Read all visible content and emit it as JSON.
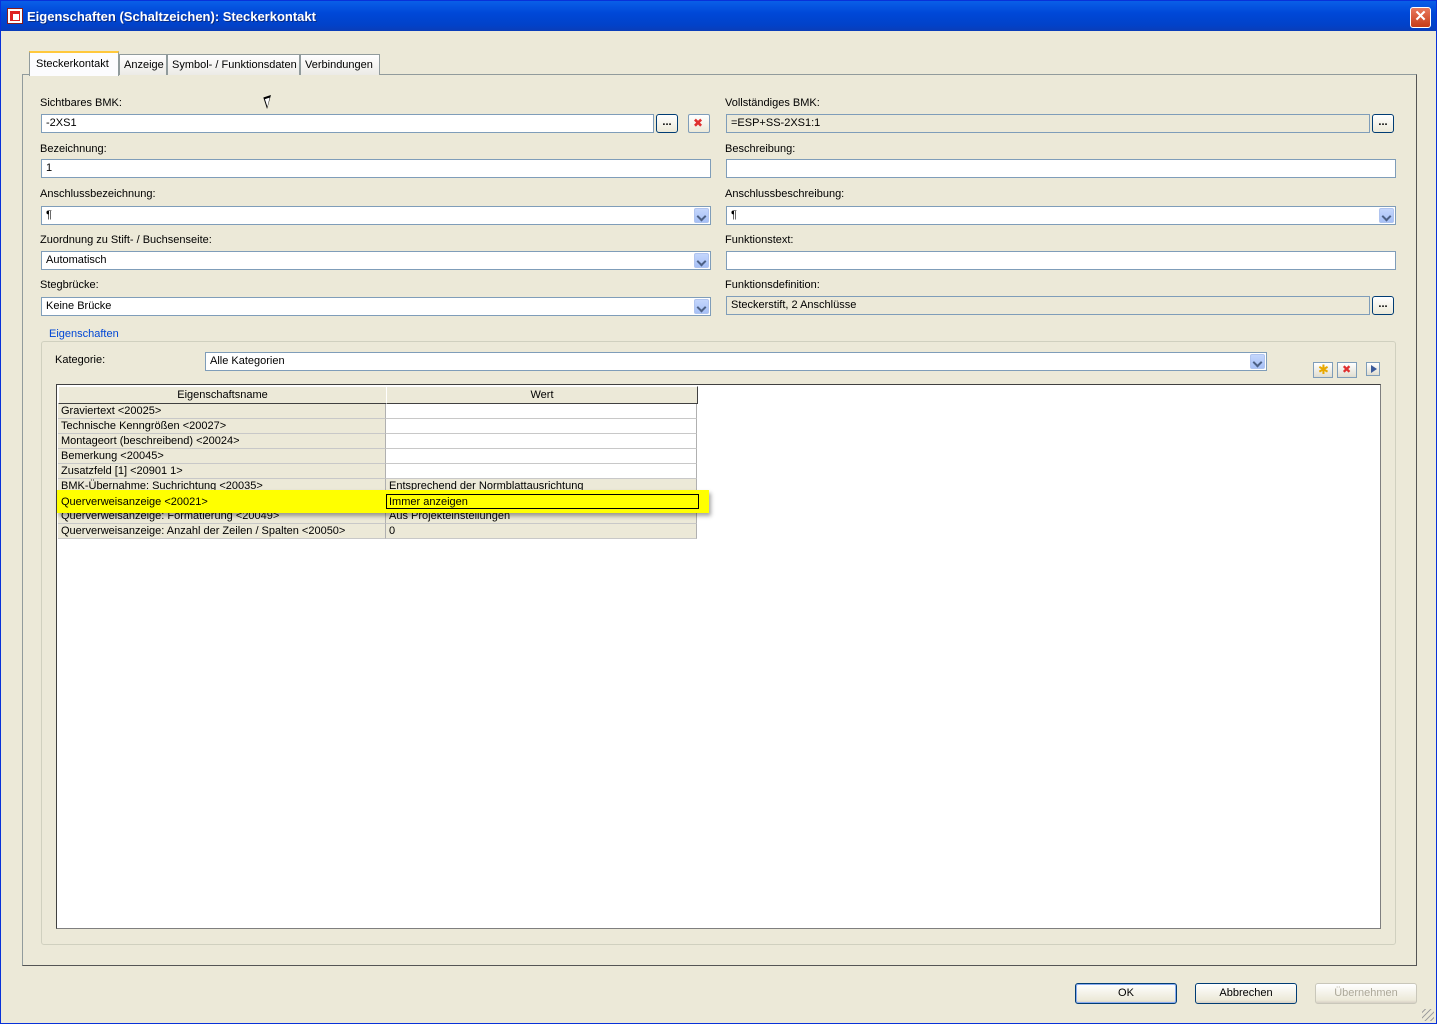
{
  "window": {
    "title": "Eigenschaften (Schaltzeichen): Steckerkontakt"
  },
  "tabs": [
    {
      "label": "Steckerkontakt",
      "active": true
    },
    {
      "label": "Anzeige",
      "active": false
    },
    {
      "label": "Symbol- / Funktionsdaten",
      "active": false
    },
    {
      "label": "Verbindungen",
      "active": false
    }
  ],
  "form": {
    "sichtbares_bmk": {
      "label": "Sichtbares BMK:",
      "value": "-2XS1"
    },
    "vollstaendiges_bmk": {
      "label": "Vollständiges BMK:",
      "value": "=ESP+SS-2XS1:1"
    },
    "bezeichnung": {
      "label": "Bezeichnung:",
      "value": "1"
    },
    "beschreibung": {
      "label": "Beschreibung:",
      "value": ""
    },
    "anschlussbezeichnung": {
      "label": "Anschlussbezeichnung:",
      "value": "¶"
    },
    "anschlussbeschreibung": {
      "label": "Anschlussbeschreibung:",
      "value": "¶"
    },
    "zuordnung": {
      "label": "Zuordnung zu Stift- / Buchsenseite:",
      "value": "Automatisch"
    },
    "funktionstext": {
      "label": "Funktionstext:",
      "value": ""
    },
    "stegbruecke": {
      "label": "Stegbrücke:",
      "value": "Keine Brücke"
    },
    "funktionsdefinition": {
      "label": "Funktionsdefinition:",
      "value": "Steckerstift, 2 Anschlüsse"
    },
    "ellipsis": "..."
  },
  "properties": {
    "group_title": "Eigenschaften",
    "category_label": "Kategorie:",
    "category_value": "Alle Kategorien",
    "columns": [
      "Eigenschaftsname",
      "Wert"
    ],
    "rows": [
      {
        "name": "Graviertext <20025>",
        "value": ""
      },
      {
        "name": "Technische Kenngrößen <20027>",
        "value": ""
      },
      {
        "name": "Montageort (beschreibend) <20024>",
        "value": ""
      },
      {
        "name": "Bemerkung <20045>",
        "value": ""
      },
      {
        "name": "Zusatzfeld [1] <20901 1>",
        "value": ""
      },
      {
        "name": "BMK-Übernahme: Suchrichtung <20035>",
        "value": "Entsprechend der Normblattausrichtung"
      },
      {
        "name": "Querverweisanzeige <20021>",
        "value": "Immer anzeigen"
      },
      {
        "name": "Querverweisanzeige: Formatierung <20049>",
        "value": "Aus Projekteinstellungen"
      },
      {
        "name": "Querverweisanzeige: Anzahl der Zeilen / Spalten <20050>",
        "value": "0"
      }
    ]
  },
  "buttons": {
    "ok": "OK",
    "cancel": "Abbrechen",
    "apply": "Übernehmen"
  },
  "colors": {
    "highlight": "#ffff00",
    "title_bar": "#0048d8",
    "group_title": "#0046d5"
  }
}
